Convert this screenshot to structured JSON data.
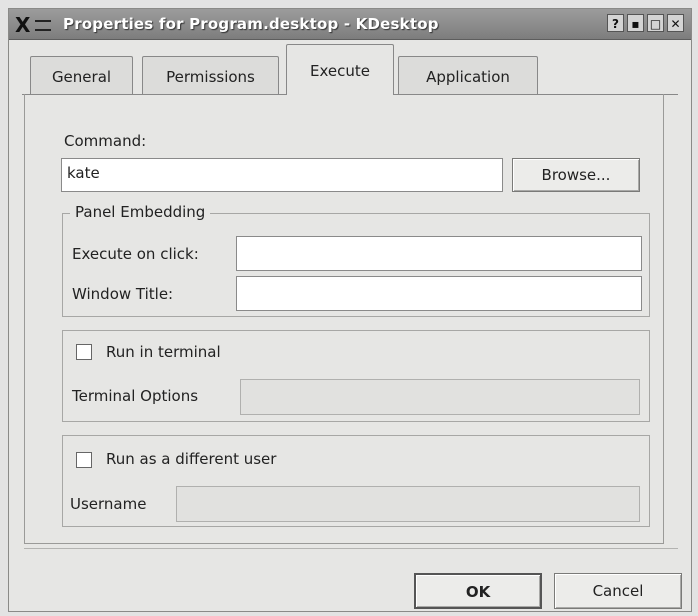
{
  "window": {
    "title": "Properties for Program.desktop - KDesktop",
    "controls": {
      "help": "?",
      "minimize": "▪",
      "maximize": "□",
      "close": "✕"
    }
  },
  "tabs": [
    {
      "label": "General",
      "active": false
    },
    {
      "label": "Permissions",
      "active": false
    },
    {
      "label": "Execute",
      "active": true
    },
    {
      "label": "Application",
      "active": false
    }
  ],
  "execute": {
    "command_label": "Command:",
    "command_value": "kate",
    "browse_label": "Browse...",
    "panel_embedding": {
      "legend": "Panel Embedding",
      "execute_on_click_label": "Execute on click:",
      "execute_on_click_value": "",
      "window_title_label": "Window Title:",
      "window_title_value": ""
    },
    "terminal": {
      "run_in_terminal_label": "Run in terminal",
      "run_in_terminal_checked": false,
      "terminal_options_label": "Terminal Options",
      "terminal_options_value": ""
    },
    "user": {
      "run_as_label": "Run as a different user",
      "run_as_checked": false,
      "username_label": "Username",
      "username_value": ""
    }
  },
  "buttons": {
    "ok": "OK",
    "cancel": "Cancel"
  }
}
